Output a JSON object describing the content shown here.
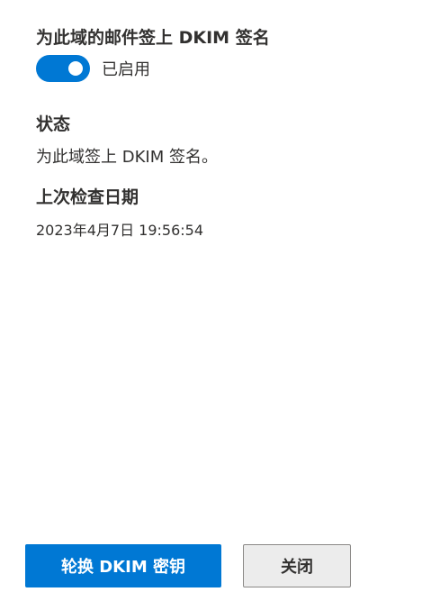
{
  "dkim_signing": {
    "title": "为此域的邮件签上 DKIM 签名",
    "toggle_state_label": "已启用",
    "toggle_on": true
  },
  "status": {
    "title": "状态",
    "value": "为此域签上 DKIM 签名。"
  },
  "last_checked": {
    "title": "上次检查日期",
    "value": "2023年4月7日 19:56:54"
  },
  "actions": {
    "rotate_label": "轮换 DKIM 密钥",
    "close_label": "关闭"
  },
  "colors": {
    "accent": "#0078d4",
    "text": "#323130"
  }
}
